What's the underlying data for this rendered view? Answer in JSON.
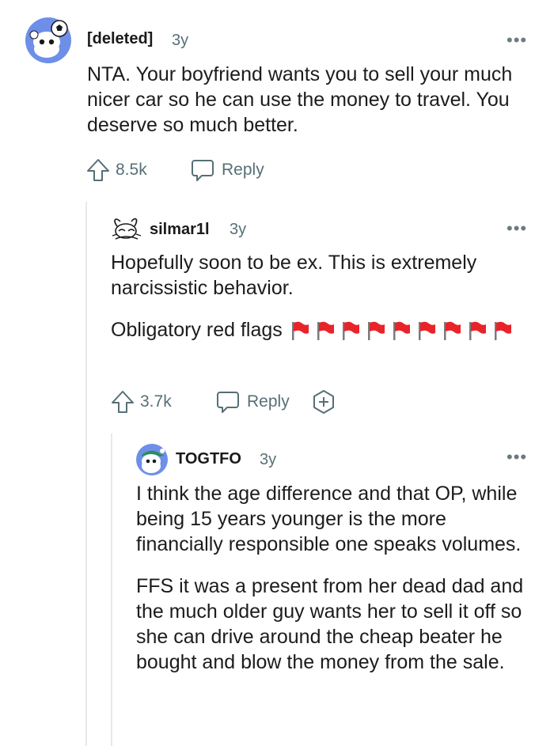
{
  "comments": [
    {
      "username": "[deleted]",
      "age": "3y",
      "paragraphs": [
        "NTA. Your boyfriend wants you to sell your much nicer car so he can use the money to travel. You deserve so much better."
      ],
      "votes": "8.5k",
      "reply_label": "Reply",
      "avatar_icon": "snoo-soccer-avatar-icon"
    },
    {
      "username": "silmar1l",
      "age": "3y",
      "paragraphs": [
        "Hopefully soon to be ex. This is extremely narcissistic behavior.",
        "Obligatory red flags"
      ],
      "flag_count": 9,
      "votes": "3.7k",
      "reply_label": "Reply",
      "avatar_icon": "sketch-bunny-avatar-icon"
    },
    {
      "username": "TOGTFO",
      "age": "3y",
      "paragraphs": [
        "I think the age difference and that OP, while being 15 years younger is the more financially responsible one speaks volumes.",
        "FFS it was a present from her dead dad and the much older guy wants her to sell it off so she can drive around the cheap beater he bought and blow the money from the sale."
      ],
      "avatar_icon": "snoo-cap-avatar-icon"
    }
  ],
  "more_options": "•••",
  "colors": {
    "muted": "#576f76",
    "thread_line": "#e5e9ec",
    "flag_red": "#e8232a",
    "avatar_blue": "#6e8fe8"
  }
}
